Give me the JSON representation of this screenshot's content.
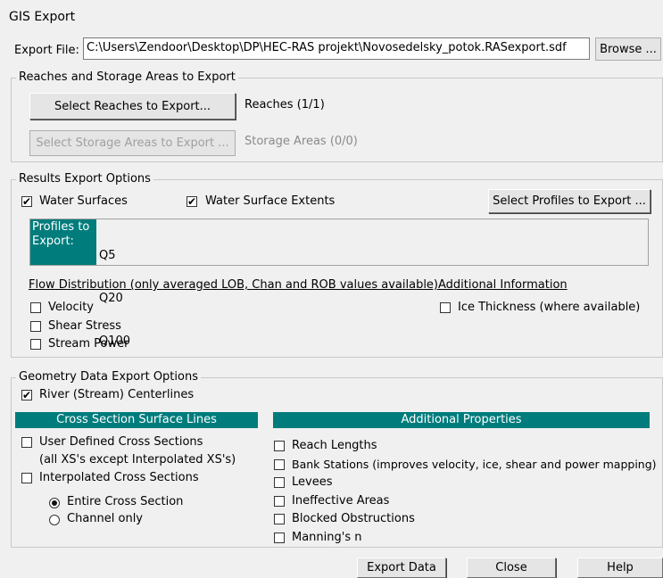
{
  "window": {
    "title": "GIS Export"
  },
  "export_file": {
    "label": "Export File:",
    "value": "C:\\Users\\Zendoor\\Desktop\\DP\\HEC-RAS projekt\\Novosedelsky_potok.RASexport.sdf",
    "browse_label": "Browse ..."
  },
  "reaches_group": {
    "legend": "Reaches and Storage Areas to Export",
    "select_reaches_label": "Select Reaches to Export...",
    "reaches_status": "Reaches (1/1)",
    "select_storage_label": "Select Storage Areas to Export ...",
    "storage_status": "Storage Areas (0/0)"
  },
  "results_group": {
    "legend": "Results Export Options",
    "water_surfaces": {
      "label": "Water Surfaces",
      "checked": true
    },
    "water_surface_extents": {
      "label": "Water Surface Extents",
      "checked": true
    },
    "select_profiles_label": "Select Profiles to Export ...",
    "profiles_header": "Profiles to Export:",
    "profiles": [
      "Q5",
      "Q20",
      "Q100"
    ],
    "flow_distribution_heading": "Flow Distribution (only averaged LOB, Chan and ROB values available)",
    "flow_options": [
      {
        "label": "Velocity",
        "checked": false
      },
      {
        "label": "Shear Stress",
        "checked": false
      },
      {
        "label": "Stream Power",
        "checked": false
      }
    ],
    "additional_info_heading": "Additional Information",
    "ice_thickness": {
      "label": "Ice Thickness (where available)",
      "checked": false
    }
  },
  "geometry_group": {
    "legend": "Geometry Data Export Options",
    "river_centerlines": {
      "label": "River (Stream) Centerlines",
      "checked": true
    },
    "xs_header": "Cross Section Surface Lines",
    "user_defined_xs": {
      "label": "User Defined Cross Sections",
      "sublabel": "(all XS's except Interpolated XS's)",
      "checked": false
    },
    "interpolated_xs": {
      "label": "Interpolated Cross Sections",
      "checked": false
    },
    "entire_xs": {
      "label": "Entire Cross Section",
      "selected": true
    },
    "channel_only": {
      "label": "Channel only",
      "selected": false
    },
    "props_header": "Additional Properties",
    "properties": [
      {
        "label": "Reach Lengths",
        "checked": false
      },
      {
        "label": "Bank Stations (improves velocity, ice, shear and power mapping)",
        "checked": false
      },
      {
        "label": "Levees",
        "checked": false
      },
      {
        "label": "Ineffective Areas",
        "checked": false
      },
      {
        "label": "Blocked Obstructions",
        "checked": false
      },
      {
        "label": "Manning's n",
        "checked": false
      }
    ]
  },
  "footer": {
    "export_label": "Export Data",
    "close_label": "Close",
    "help_label": "Help"
  },
  "icons": {
    "check": "✔"
  },
  "colors": {
    "section_header": "#007c7c"
  }
}
